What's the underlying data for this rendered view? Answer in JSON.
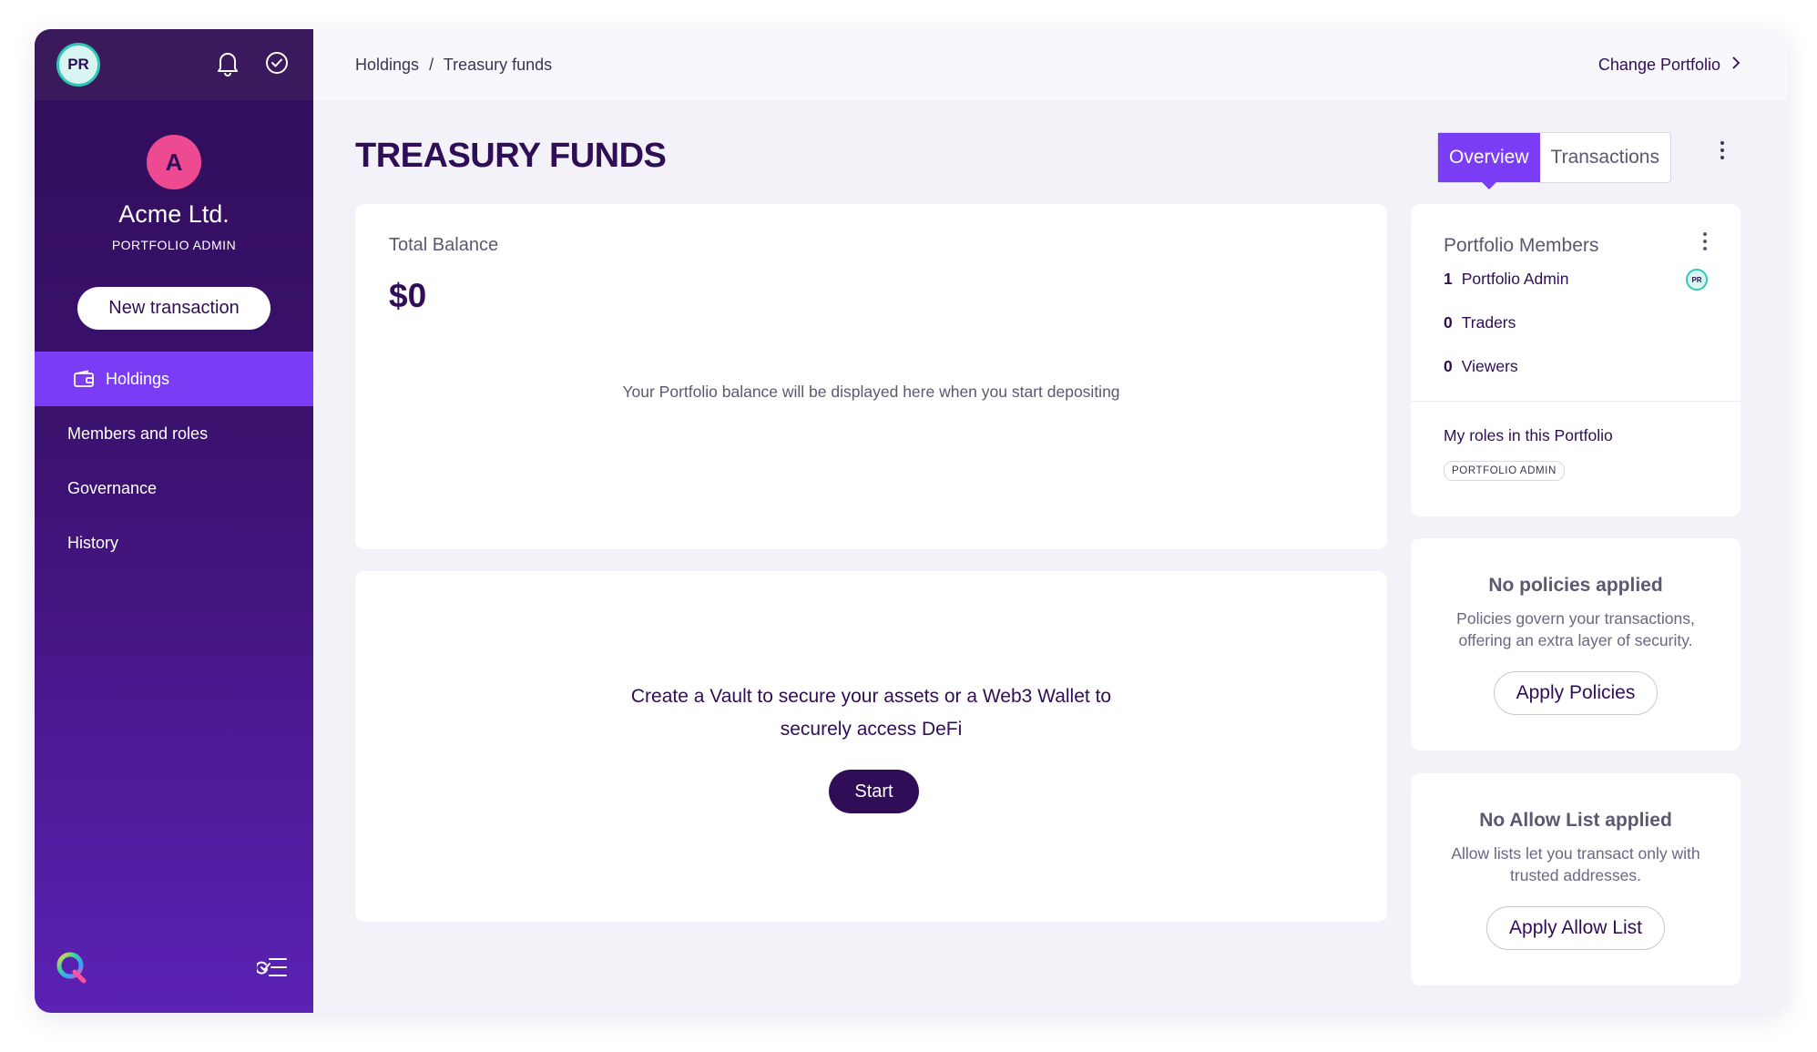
{
  "user": {
    "initials": "PR"
  },
  "org": {
    "initial": "A",
    "name": "Acme Ltd.",
    "role": "PORTFOLIO ADMIN"
  },
  "sidebar": {
    "new_transaction_label": "New transaction",
    "items": [
      {
        "label": "Holdings",
        "active": true
      },
      {
        "label": "Members and roles"
      },
      {
        "label": "Governance"
      },
      {
        "label": "History"
      }
    ]
  },
  "topbar": {
    "breadcrumb": [
      "Holdings",
      "/",
      "Treasury funds"
    ],
    "change_portfolio_label": "Change Portfolio"
  },
  "page": {
    "title": "TREASURY FUNDS",
    "tabs": [
      {
        "label": "Overview",
        "active": true
      },
      {
        "label": "Transactions"
      }
    ]
  },
  "balance": {
    "label": "Total Balance",
    "value": "$0",
    "note": "Your Portfolio balance will be displayed here when you start depositing"
  },
  "vault": {
    "line1": "Create a Vault to secure your assets or a Web3 Wallet to",
    "line2": "securely access DeFi",
    "start_label": "Start"
  },
  "members": {
    "title": "Portfolio Members",
    "rows": [
      {
        "count": "1",
        "label": "Portfolio Admin",
        "avatar": "PR"
      },
      {
        "count": "0",
        "label": "Traders"
      },
      {
        "count": "0",
        "label": "Viewers"
      }
    ],
    "my_roles_label": "My roles in this Portfolio",
    "my_role_badge": "PORTFOLIO ADMIN"
  },
  "policies": {
    "title": "No policies applied",
    "desc": "Policies govern your transactions, offering an extra layer of security.",
    "button": "Apply Policies"
  },
  "allow_list": {
    "title": "No Allow List applied",
    "desc": "Allow lists let you transact only with trusted addresses.",
    "button": "Apply Allow List"
  },
  "colors": {
    "brand_dark": "#2f0d57",
    "accent": "#7a3cf5",
    "org_avatar": "#ee4a92",
    "user_avatar_ring": "#2fc8b6"
  }
}
